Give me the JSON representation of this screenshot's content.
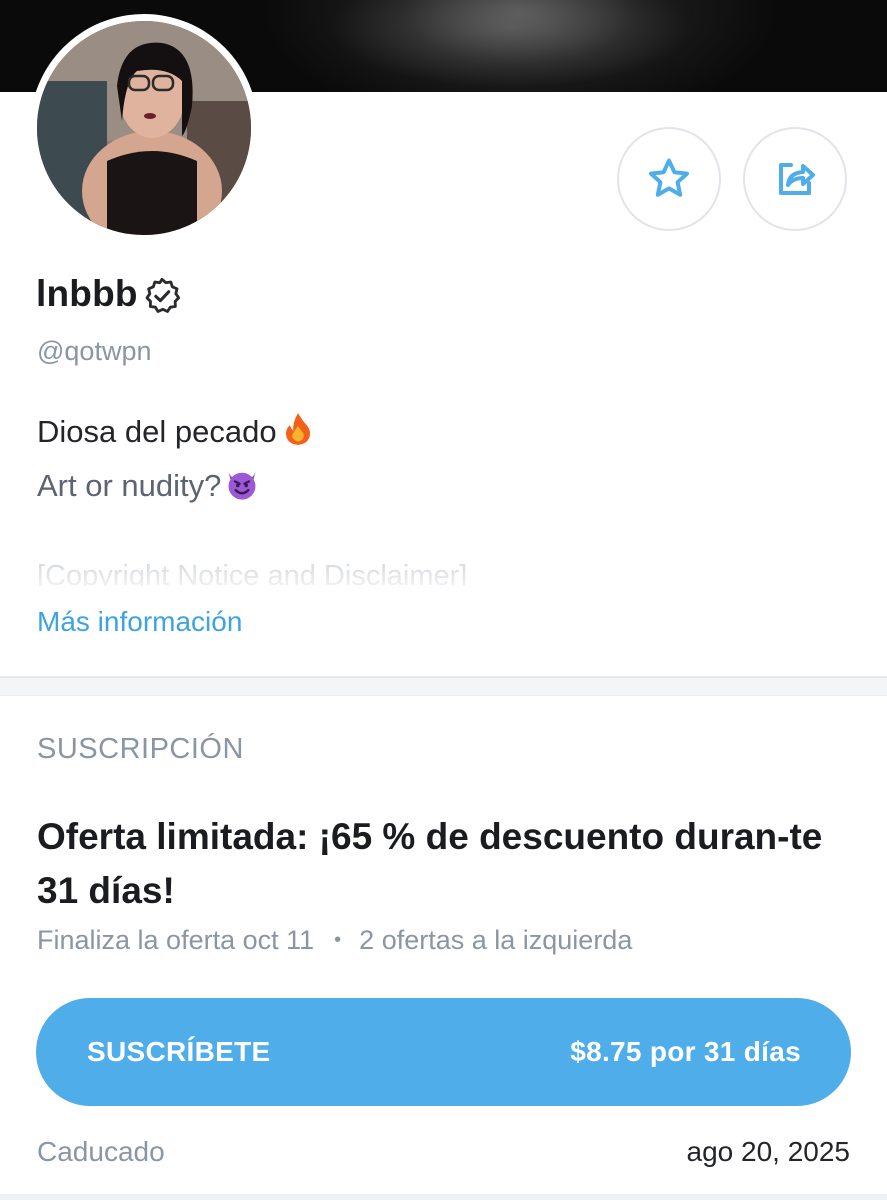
{
  "profile": {
    "name": "lnbbb",
    "handle": "@qotwpn",
    "bio_line1": "Diosa del pecado",
    "bio_line2": "Art or nudity?",
    "bio_faded": "[Copyright Notice and Disclaimer]",
    "more_info": "Más información",
    "verified": true
  },
  "actions": {
    "favorite_icon": "star-icon",
    "share_icon": "share-icon"
  },
  "subscription": {
    "section_title": "SUSCRIPCIÓN",
    "offer_title": "Oferta limitada: ¡65 % de descuento duran-te 31 días!",
    "offer_ends": "Finaliza la oferta oct 11",
    "separator": "•",
    "offers_left": "2 ofertas a la izquierda",
    "button_label": "SUSCRÍBETE",
    "button_price": "$8.75 por 31 días",
    "expired_label": "Caducado",
    "expired_date": "ago 20, 2025"
  },
  "colors": {
    "accent": "#4fade9",
    "link": "#3ea3e1",
    "muted": "#8a96a3",
    "text": "#1b1c1f"
  }
}
